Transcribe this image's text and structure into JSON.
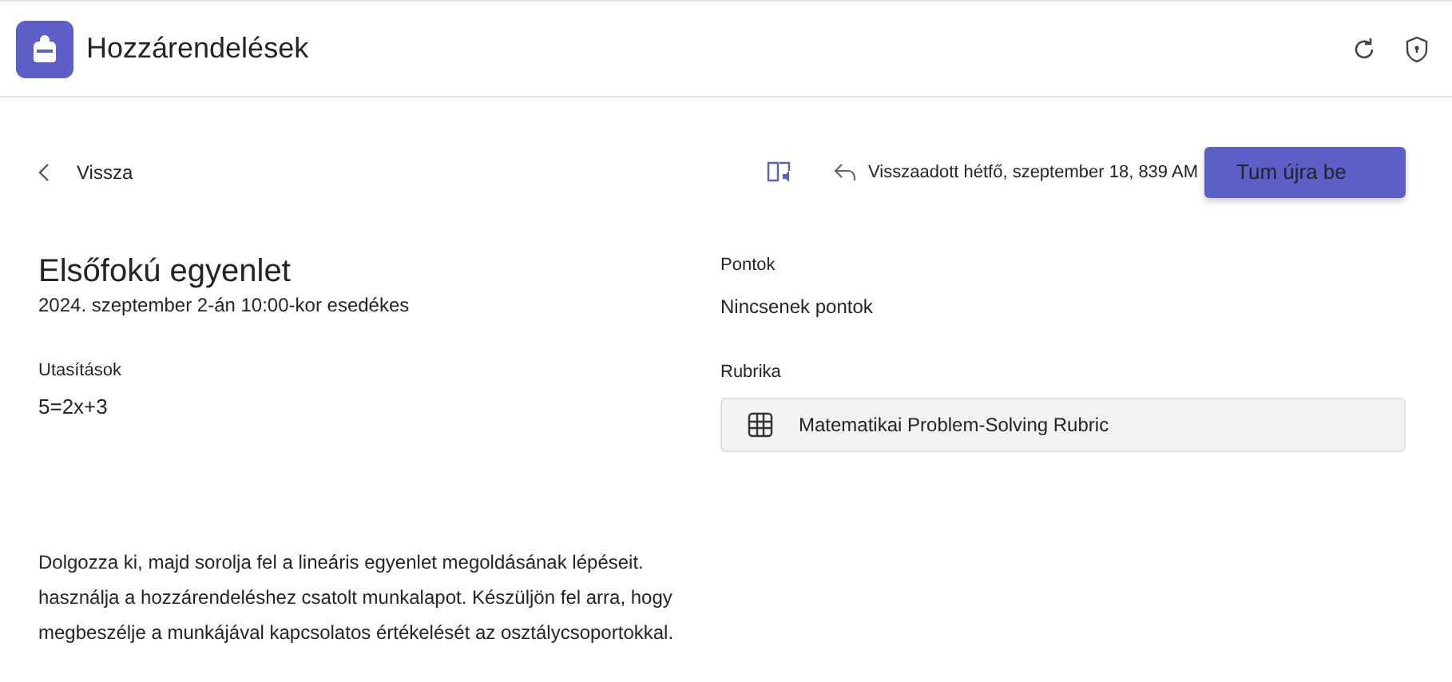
{
  "app": {
    "title": "Hozzárendelések"
  },
  "toolbar": {
    "back": "Vissza",
    "returned": "Visszaadott hétfő, szeptember 18, 839 AM",
    "submit_button": "Tum újra be"
  },
  "assignment": {
    "title": "Elsőfokú egyenlet",
    "due": "2024. szeptember 2-án 10:00-kor esedékes",
    "instructions_label": "Utasítások",
    "instructions": "5=2x+3",
    "description_lines": [
      "Dolgozza ki, majd sorolja fel a lineáris egyenlet megoldásának lépéseit.",
      "használja a hozzárendeléshez csatolt munkalapot. Készüljön fel arra, hogy",
      "megbeszélje a munkájával kapcsolatos értékelését az osztálycsoportokkal."
    ]
  },
  "points": {
    "label": "Pontok",
    "value": "Nincsenek pontok"
  },
  "rubric": {
    "label": "Rubrika",
    "name": "Matematikai Problem-Solving Rubric"
  }
}
